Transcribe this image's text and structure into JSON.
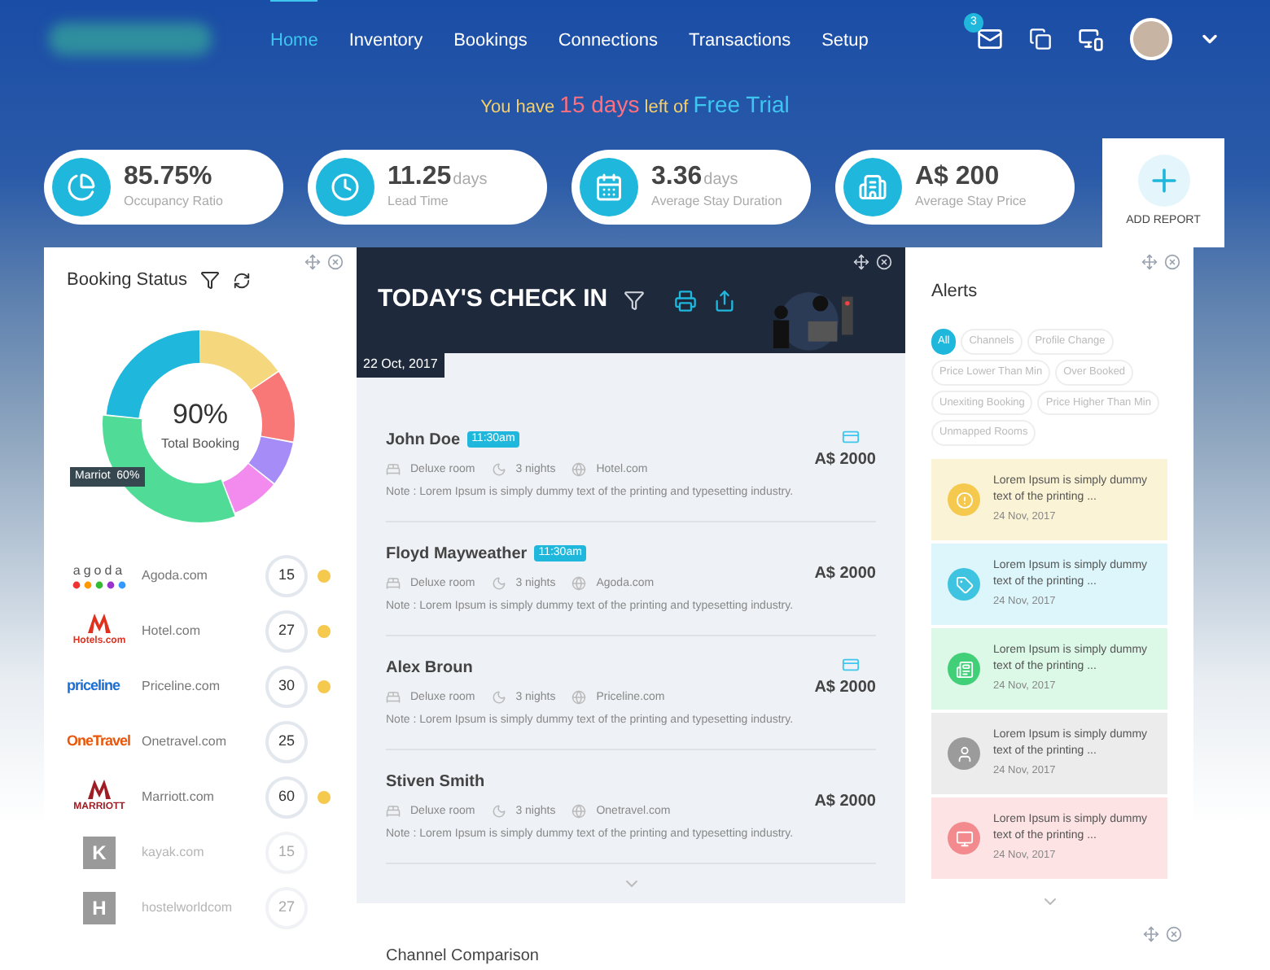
{
  "nav": {
    "items": [
      {
        "label": "Home",
        "selected": true
      },
      {
        "label": "Inventory",
        "selected": false
      },
      {
        "label": "Bookings",
        "selected": false
      },
      {
        "label": "Connections",
        "selected": false
      },
      {
        "label": "Transactions",
        "selected": false
      },
      {
        "label": "Setup",
        "selected": false
      }
    ],
    "mail_badge": "3"
  },
  "trial": {
    "prefix": "You have",
    "days": "15 days",
    "middle": "left of",
    "plan": "Free Trial"
  },
  "stats": [
    {
      "value": "85.75%",
      "label": "Occupancy Ratio"
    },
    {
      "value": "11.25",
      "unit": "days",
      "label": "Lead Time"
    },
    {
      "value": "3.36",
      "unit": "days",
      "label": "Average Stay Duration"
    },
    {
      "value": "A$ 200",
      "label": "Average Stay Price"
    }
  ],
  "add_report": {
    "label": "ADD REPORT"
  },
  "booking_status": {
    "title": "Booking Status",
    "center_value": "90%",
    "center_label": "Total Booking",
    "tooltip": "Marriot  60%",
    "channels": [
      {
        "logo": {
          "kind": "dots",
          "text": "agoda",
          "color": "#555555"
        },
        "name": "Agoda.com",
        "count": "15",
        "alert": true,
        "disabled": false
      },
      {
        "logo": {
          "kind": "badge",
          "text": "Hotels.com",
          "color": "#e0301e"
        },
        "name": "Hotel.com",
        "count": "27",
        "alert": true,
        "disabled": false
      },
      {
        "logo": {
          "kind": "word",
          "text": "priceline",
          "color": "#1a6fd6"
        },
        "name": "Priceline.com",
        "count": "30",
        "alert": true,
        "disabled": false
      },
      {
        "logo": {
          "kind": "word",
          "text": "OneTravel",
          "color": "#e8580c"
        },
        "name": "Onetravel.com",
        "count": "25",
        "alert": false,
        "disabled": false
      },
      {
        "logo": {
          "kind": "badge",
          "text": "MARRIOTT",
          "color": "#a01c24"
        },
        "name": "Marriott.com",
        "count": "60",
        "alert": true,
        "disabled": false
      },
      {
        "logo": {
          "kind": "tile",
          "text": "K",
          "color": "#9a9a9a"
        },
        "name": "kayak.com",
        "count": "15",
        "alert": false,
        "disabled": true
      },
      {
        "logo": {
          "kind": "tile",
          "text": "H",
          "color": "#9a9a9a"
        },
        "name": "hostelworldcom",
        "count": "27",
        "alert": false,
        "disabled": true
      }
    ]
  },
  "checkin": {
    "title": "TODAY'S CHECK IN",
    "date": "22 Oct, 2017",
    "guests": [
      {
        "name": "John Doe",
        "time": "11:30am",
        "card": true,
        "room": "Deluxe room",
        "nights": "3 nights",
        "channel": "Hotel.com",
        "price": "A$ 2000",
        "note": "Note : Lorem Ipsum is simply dummy text of the printing and typesetting industry."
      },
      {
        "name": "Floyd Mayweather",
        "time": "11:30am",
        "card": false,
        "room": "Deluxe room",
        "nights": "3 nights",
        "channel": "Agoda.com",
        "price": "A$ 2000",
        "note": "Note : Lorem Ipsum is simply dummy text of the printing and typesetting industry."
      },
      {
        "name": "Alex Broun",
        "card": true,
        "room": "Deluxe room",
        "nights": "3 nights",
        "channel": "Priceline.com",
        "price": "A$ 2000",
        "note": "Note : Lorem Ipsum is simply dummy text of the printing and typesetting industry."
      },
      {
        "name": "Stiven Smith",
        "card": false,
        "room": "Deluxe room",
        "nights": "3 nights",
        "channel": "Onetravel.com",
        "price": "A$ 2000",
        "note": "Note : Lorem Ipsum is simply dummy text of the printing and typesetting industry."
      }
    ]
  },
  "alerts": {
    "title": "Alerts",
    "filters": [
      {
        "label": "All",
        "selected": true
      },
      {
        "label": "Channels",
        "selected": false
      },
      {
        "label": "Profile Change",
        "selected": false
      },
      {
        "label": "Price Lower Than Min",
        "selected": false
      },
      {
        "label": "Over Booked",
        "selected": false
      },
      {
        "label": "Unexiting Booking",
        "selected": false
      },
      {
        "label": "Price Higher Than Min",
        "selected": false
      },
      {
        "label": "Unmapped Rooms",
        "selected": false
      }
    ],
    "items": [
      {
        "kind": "warning",
        "text": "Lorem Ipsum is simply dummy text of the printing ...",
        "date": "24 Nov, 2017"
      },
      {
        "kind": "price",
        "text": "Lorem Ipsum is simply dummy text of the printing ...",
        "date": "24 Nov, 2017"
      },
      {
        "kind": "booking",
        "text": "Lorem Ipsum is simply dummy text of the printing ...",
        "date": "24 Nov, 2017"
      },
      {
        "kind": "profile",
        "text": "Lorem Ipsum is simply dummy text of the printing ...",
        "date": "24 Nov, 2017"
      },
      {
        "kind": "room",
        "text": "Lorem Ipsum is simply dummy text of the printing ...",
        "date": "24 Nov, 2017"
      }
    ]
  },
  "channel_comparison": {
    "title": "Channel Comparison"
  }
}
